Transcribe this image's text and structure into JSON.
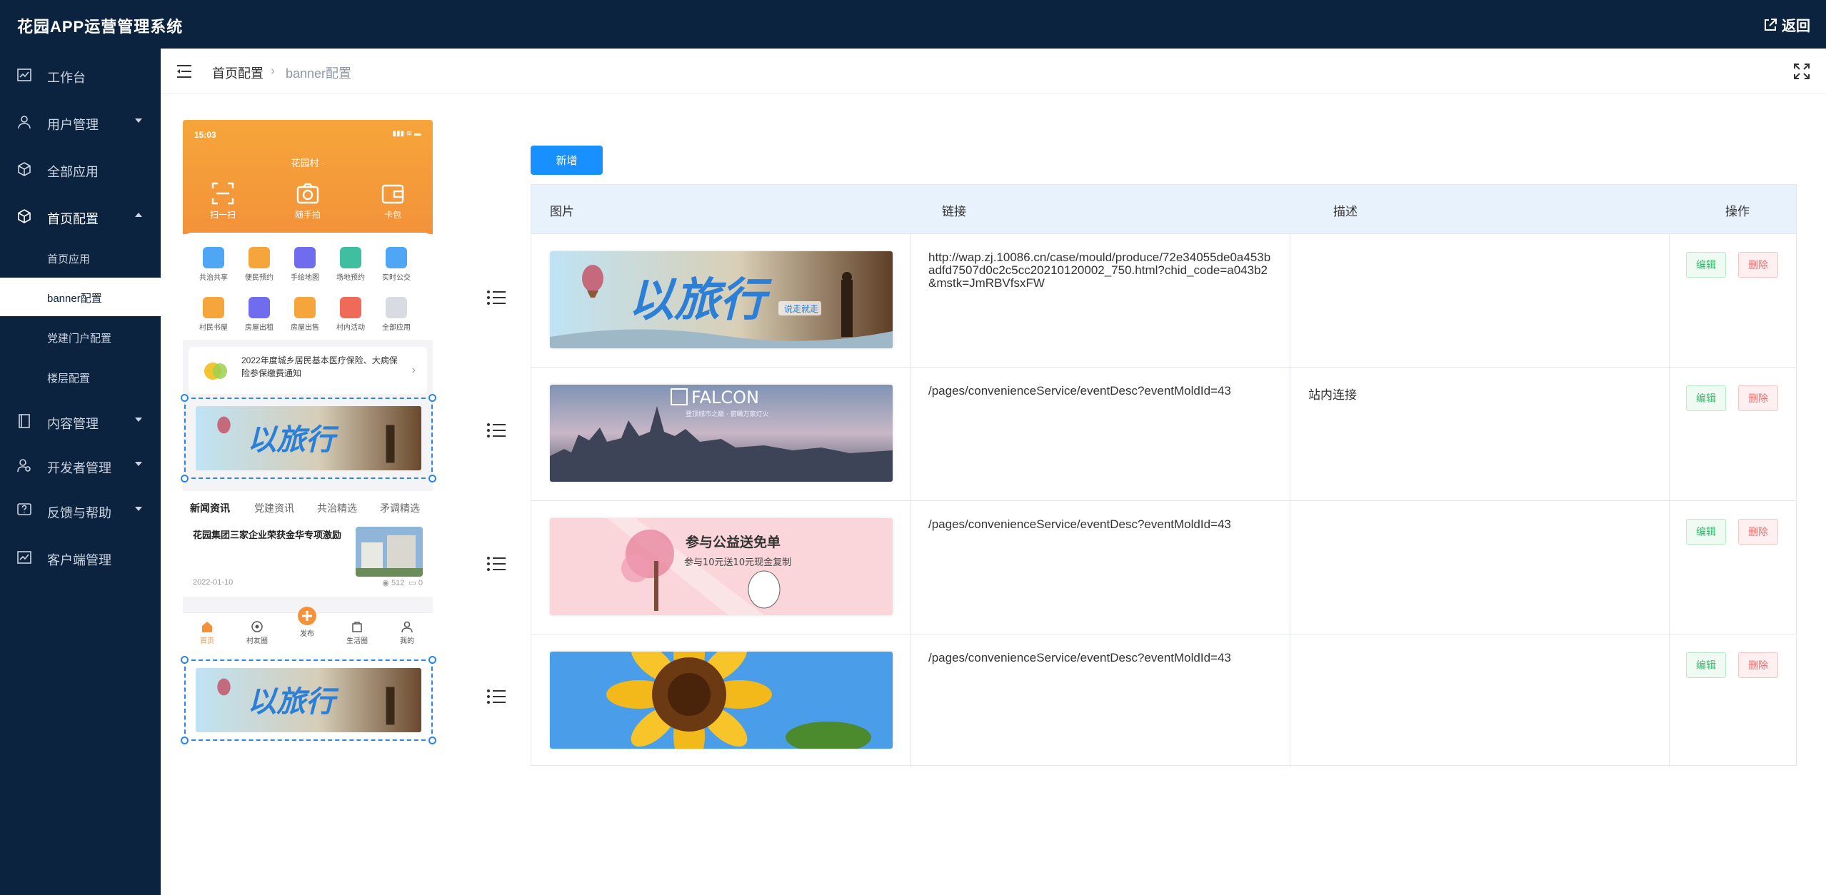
{
  "app": {
    "title": "花园APP运营管理系统",
    "back_label": "返回"
  },
  "sidebar": {
    "items": [
      {
        "label": "工作台",
        "icon": "chart-line-icon"
      },
      {
        "label": "用户管理",
        "icon": "user-icon"
      },
      {
        "label": "全部应用",
        "icon": "cube-icon"
      },
      {
        "label": "首页配置",
        "icon": "cube-icon"
      },
      {
        "label": "内容管理",
        "icon": "book-icon"
      },
      {
        "label": "开发者管理",
        "icon": "developer-icon"
      },
      {
        "label": "反馈与帮助",
        "icon": "question-icon"
      },
      {
        "label": "客户端管理",
        "icon": "chart-line-icon"
      }
    ],
    "sub_items": [
      "首页应用",
      "banner配置",
      "党建门户配置",
      "楼层配置"
    ]
  },
  "breadcrumb": {
    "parent": "首页配置",
    "current": "banner配置"
  },
  "phone": {
    "time": "15:03",
    "village": "花园村 ·",
    "tools": [
      "扫一扫",
      "随手拍",
      "卡包"
    ],
    "services": [
      "共治共享",
      "便民预约",
      "手绘地图",
      "场地预约",
      "实时公交",
      "村民书屋",
      "房屋出租",
      "房屋出售",
      "村内活动",
      "全部应用"
    ],
    "notice": "2022年度城乡居民基本医疗保险、大病保险参保缴费通知",
    "tabs": [
      "新闻资讯",
      "党建资讯",
      "共治精选",
      "矛调精选"
    ],
    "news": {
      "title": "花园集团三家企业荣获金华专项激励",
      "date": "2022-01-10",
      "views": "512",
      "comments": "0"
    },
    "bottom_nav": [
      "首页",
      "村友圈",
      "发布",
      "生活圈",
      "我的"
    ]
  },
  "toolbar": {
    "add_label": "新增"
  },
  "table": {
    "headers": [
      "图片",
      "链接",
      "描述",
      "操作"
    ],
    "rows": [
      {
        "image": "travel-banner",
        "link": "http://wap.zj.10086.cn/case/mould/produce/72e34055de0a453badfd7507d0c2c5cc20210120002_750.html?chid_code=a043b2&mstk=JmRBVfsxFW",
        "desc": ""
      },
      {
        "image": "falcon-city-banner",
        "link": "/pages/convenienceService/eventDesc?eventMoldId=43",
        "desc": "站内连接"
      },
      {
        "image": "charity-banner",
        "link": "/pages/convenienceService/eventDesc?eventMoldId=43",
        "desc": ""
      },
      {
        "image": "sunflower-banner",
        "link": "/pages/convenienceService/eventDesc?eventMoldId=43",
        "desc": ""
      }
    ],
    "edit_label": "编辑",
    "delete_label": "删除"
  },
  "banner_text": {
    "travel": "以旅行",
    "travel_badge": "说走就走",
    "falcon": "FALCON",
    "falcon_sub": "登顶城市之巅 · 俯瞰万家灯火",
    "charity_1": "参与公益送免单",
    "charity_2": "参与10元送10元现金复制"
  },
  "colors": {
    "topbar": "#0c2340",
    "primary": "#1890ff",
    "edit": "#36b66b",
    "delete": "#f56c6c",
    "phone_orange": "#f3923a"
  }
}
